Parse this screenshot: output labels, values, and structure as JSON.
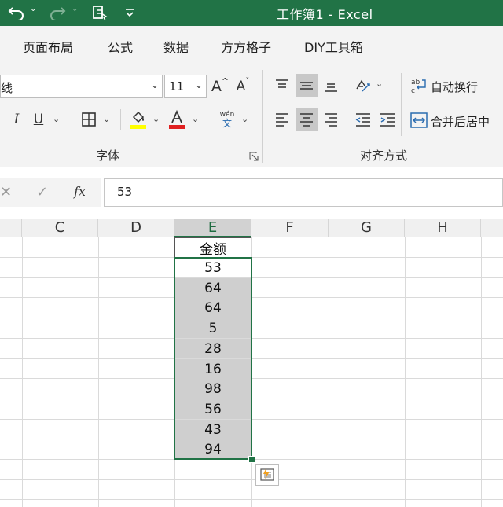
{
  "titlebar": {
    "title": "工作簿1  -  Excel",
    "icons": [
      "undo-icon",
      "redo-icon",
      "touch-mode-icon",
      "customize-qat-icon"
    ]
  },
  "tabs": [
    "页面布局",
    "公式",
    "数据",
    "方方格子",
    "DIY工具箱"
  ],
  "ribbon": {
    "font_name": "线",
    "font_size": "11",
    "grow_font": "A",
    "shrink_font": "A",
    "italic": "I",
    "underline": "U",
    "font_group_label": "字体",
    "align_group_label": "对齐方式",
    "wrap_text_label": "自动换行",
    "merge_center_label": "合并后居中",
    "phonetic_top": "wén",
    "phonetic_bottom": "文",
    "colors": {
      "highlight": "#ffff00",
      "font_color": "#e02020",
      "brand": "#217346"
    }
  },
  "formula_bar": {
    "cancel": "✕",
    "enter": "✓",
    "fx": "fx",
    "value": "53"
  },
  "grid": {
    "columns": [
      "C",
      "D",
      "E",
      "F",
      "G",
      "H"
    ],
    "active_column": "E",
    "header": "金额",
    "values": [
      "53",
      "64",
      "64",
      "5",
      "28",
      "16",
      "98",
      "56",
      "43",
      "94"
    ]
  }
}
